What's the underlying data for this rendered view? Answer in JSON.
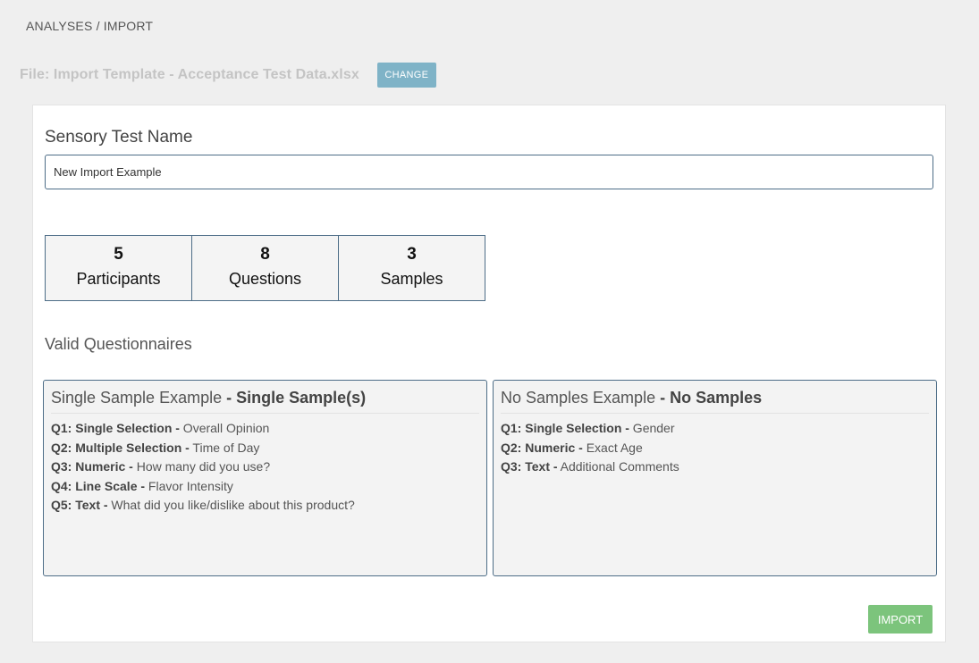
{
  "breadcrumb": "ANALYSES / IMPORT",
  "file": {
    "label": "File: Import Template - Acceptance Test Data.xlsx",
    "change_label": "CHANGE"
  },
  "test_name": {
    "label": "Sensory Test Name",
    "value": "New Import Example"
  },
  "stats": [
    {
      "value": "5",
      "label": "Participants"
    },
    {
      "value": "8",
      "label": "Questions"
    },
    {
      "value": "3",
      "label": "Samples"
    }
  ],
  "valid_label": "Valid Questionnaires",
  "questionnaires": [
    {
      "name": "Single Sample Example",
      "type": "- Single Sample(s)",
      "questions": [
        {
          "prefix": "Q1: Single Selection -",
          "text": " Overall Opinion"
        },
        {
          "prefix": "Q2: Multiple Selection -",
          "text": " Time of Day"
        },
        {
          "prefix": "Q3: Numeric -",
          "text": " How many did you use?"
        },
        {
          "prefix": "Q4: Line Scale -",
          "text": " Flavor Intensity"
        },
        {
          "prefix": "Q5: Text -",
          "text": " What did you like/dislike about this product?"
        }
      ]
    },
    {
      "name": "No Samples Example",
      "type": "- No Samples",
      "questions": [
        {
          "prefix": "Q1: Single Selection -",
          "text": " Gender"
        },
        {
          "prefix": "Q2: Numeric -",
          "text": " Exact Age"
        },
        {
          "prefix": "Q3: Text -",
          "text": " Additional Comments"
        }
      ]
    }
  ],
  "import_label": "IMPORT",
  "colors": {
    "change_button": "#7fb3c7",
    "import_button": "#7cc47c",
    "border_accent": "#4d6d87",
    "background": "#efefef"
  }
}
